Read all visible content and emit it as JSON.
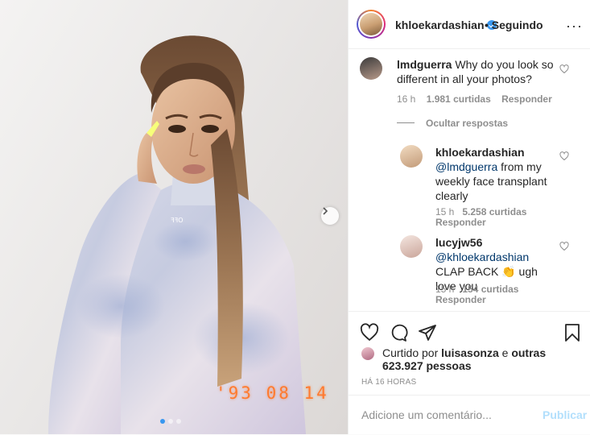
{
  "post": {
    "stamp": "'93 08 14"
  },
  "header": {
    "username": "khloekardashian",
    "separator": "•",
    "following": "Seguindo",
    "more": "···"
  },
  "comments": [
    {
      "username": "lmdguerra",
      "text": "Why do you look so different in all your photos?",
      "age": "16 h",
      "likes": "1.981 curtidas",
      "reply": "Responder"
    }
  ],
  "hide_replies": "Ocultar respostas",
  "replies": [
    {
      "username": "khloekardashian",
      "mention": "@lmdguerra",
      "text": "from my weekly face transplant clearly",
      "age": "15 h",
      "likes": "5.258 curtidas",
      "reply": "Responder"
    },
    {
      "username": "lucyjw56",
      "mention": "@khloekardashian",
      "text": "CLAP BACK 👏 ugh love you",
      "age": "15 h",
      "likes": "154 curtidas",
      "reply": "Responder"
    }
  ],
  "likes": {
    "prefix": "Curtido por",
    "user": "luisasonza",
    "middle": "e",
    "others": "outras 623.927 pessoas"
  },
  "time": "HÁ 16 HORAS",
  "add_comment": {
    "placeholder": "Adicione um comentário...",
    "publish": "Publicar"
  },
  "colors": {
    "link": "#00376b",
    "muted": "#8e8e8e",
    "accent": "#3897f0",
    "publish_disabled": "#b2dffc",
    "stamp": "#ff7a2f"
  },
  "icons": [
    "verified-icon",
    "heart-icon",
    "comment-icon",
    "share-icon",
    "bookmark-icon",
    "chevron-right-icon"
  ]
}
